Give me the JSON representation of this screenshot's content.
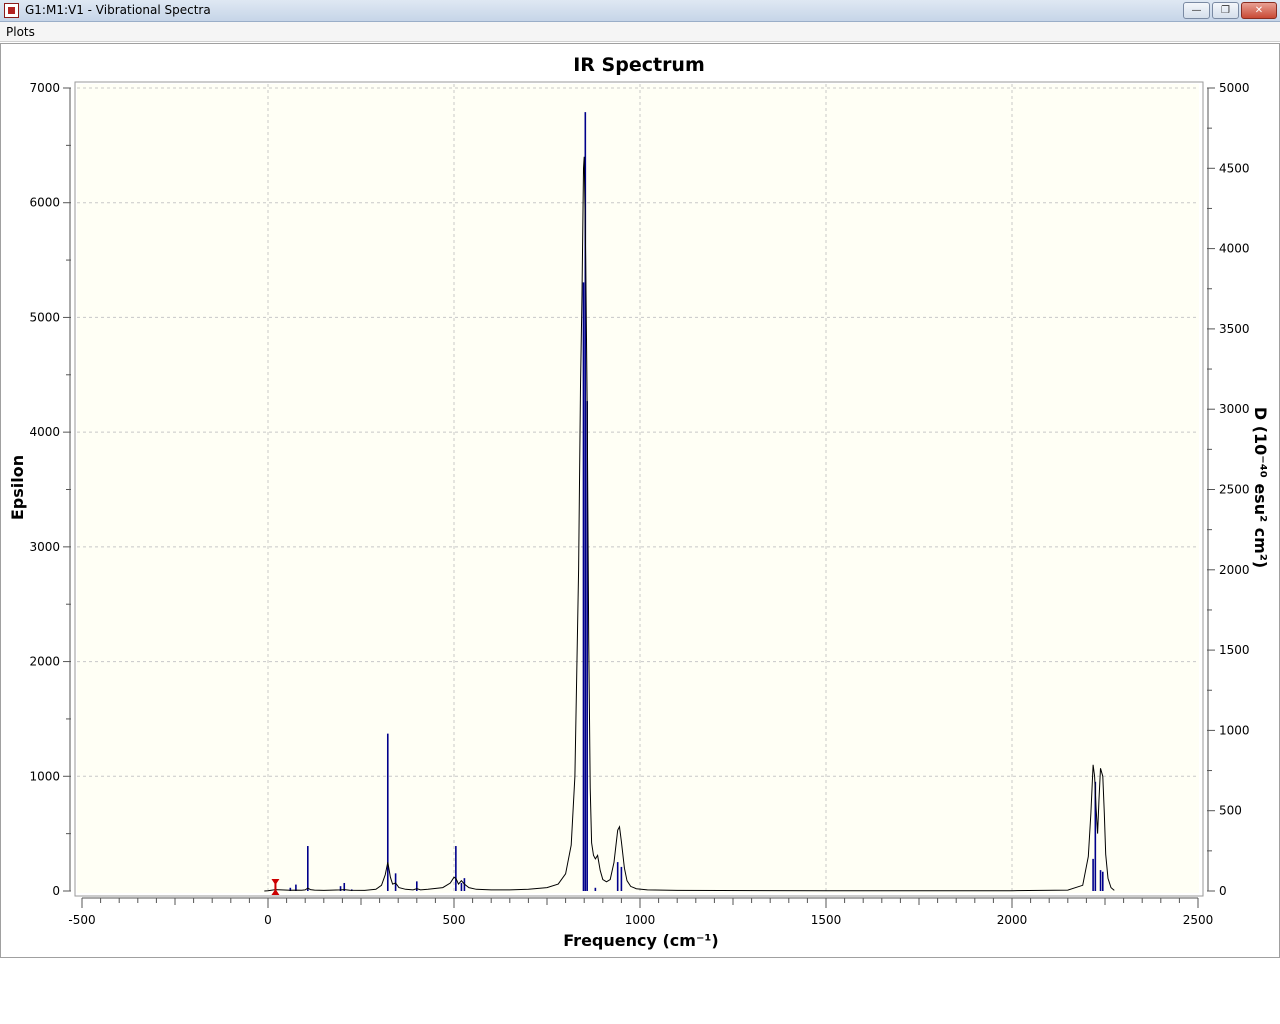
{
  "window": {
    "title": "G1:M1:V1 - Vibrational Spectra",
    "minimize_glyph": "—",
    "maximize_glyph": "❐",
    "close_glyph": "✕"
  },
  "menu": {
    "items": [
      {
        "label": "Plots"
      }
    ]
  },
  "chart_data": {
    "type": "line",
    "title": "IR Spectrum",
    "xlabel": "Frequency (cm⁻¹)",
    "ylabel": "Epsilon",
    "ylabel_right": "D (10⁻⁴⁰ esu² cm²)",
    "xlim": [
      -500,
      2500
    ],
    "ylim": [
      0,
      7000
    ],
    "ylim_right": [
      0,
      5000
    ],
    "x_ticks": [
      -500,
      0,
      500,
      1000,
      1500,
      2000,
      2500
    ],
    "y_ticks": [
      0,
      1000,
      2000,
      3000,
      4000,
      5000,
      6000,
      7000
    ],
    "y_ticks_right": [
      0,
      500,
      1000,
      1500,
      2000,
      2500,
      3000,
      3500,
      4000,
      4500,
      5000
    ],
    "grid": true,
    "colors": {
      "plot_background": "#fffff5",
      "spectrum": "#000000",
      "stick": "#00008b",
      "marker": "#cc0000"
    },
    "series": [
      {
        "type": "stick",
        "x": [
          20,
          60,
          75,
          107,
          195,
          205,
          225,
          322,
          343,
          400,
          505,
          520,
          528,
          848,
          853,
          858,
          880,
          940,
          950,
          2218,
          2224,
          2238,
          2244
        ],
        "values": [
          30,
          20,
          40,
          280,
          30,
          50,
          10,
          980,
          110,
          60,
          280,
          50,
          80,
          3790,
          4850,
          3050,
          20,
          180,
          150,
          200,
          680,
          130,
          120
        ]
      },
      {
        "type": "curve",
        "x": [
          -10,
          0,
          20,
          60,
          75,
          90,
          100,
          107,
          114,
          125,
          150,
          195,
          205,
          220,
          260,
          290,
          305,
          315,
          322,
          329,
          335,
          343,
          352,
          370,
          390,
          400,
          410,
          430,
          470,
          490,
          500,
          505,
          512,
          520,
          528,
          540,
          560,
          600,
          650,
          700,
          750,
          780,
          800,
          815,
          825,
          835,
          840,
          844,
          848,
          850,
          852,
          854,
          858,
          862,
          866,
          870,
          875,
          880,
          886,
          893,
          900,
          910,
          920,
          930,
          940,
          945,
          950,
          958,
          965,
          975,
          990,
          1020,
          1100,
          1500,
          2000,
          2150,
          2190,
          2205,
          2212,
          2218,
          2222,
          2226,
          2230,
          2234,
          2238,
          2244,
          2248,
          2252,
          2258,
          2266,
          2275
        ],
        "values": [
          0,
          2,
          12,
          6,
          8,
          6,
          10,
          25,
          12,
          8,
          5,
          10,
          12,
          6,
          5,
          15,
          50,
          140,
          250,
          120,
          60,
          70,
          30,
          15,
          10,
          20,
          10,
          15,
          30,
          70,
          120,
          110,
          60,
          90,
          60,
          30,
          15,
          10,
          10,
          15,
          30,
          60,
          150,
          400,
          1000,
          2800,
          4400,
          5200,
          6300,
          6400,
          6000,
          5500,
          4200,
          2200,
          900,
          420,
          310,
          280,
          310,
          180,
          100,
          80,
          100,
          250,
          530,
          560,
          430,
          200,
          90,
          40,
          20,
          10,
          5,
          3,
          3,
          8,
          50,
          300,
          680,
          1100,
          1000,
          720,
          500,
          800,
          1070,
          1000,
          680,
          320,
          110,
          30,
          5
        ]
      }
    ]
  }
}
